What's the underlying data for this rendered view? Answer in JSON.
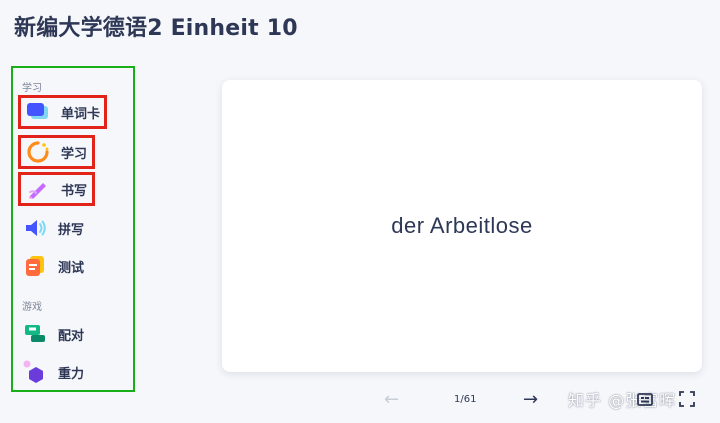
{
  "title": "新编大学德语2 Einheit 10",
  "sidebar": {
    "section_study": "学习",
    "section_games": "游戏",
    "items": [
      {
        "label": "单词卡",
        "icon": "flashcards-icon"
      },
      {
        "label": "学习",
        "icon": "learn-icon"
      },
      {
        "label": "书写",
        "icon": "write-icon"
      },
      {
        "label": "拼写",
        "icon": "spell-icon"
      },
      {
        "label": "测试",
        "icon": "test-icon"
      },
      {
        "label": "配对",
        "icon": "match-icon"
      },
      {
        "label": "重力",
        "icon": "gravity-icon"
      }
    ]
  },
  "card": {
    "term": "der Arbeitlose"
  },
  "controls": {
    "prev": "←",
    "counter": "1/61",
    "next": "→"
  },
  "watermark": "知乎 @张富晖",
  "colors": {
    "highlight_red": "#e2231a",
    "highlight_green": "#18b018",
    "text": "#2e3856"
  }
}
